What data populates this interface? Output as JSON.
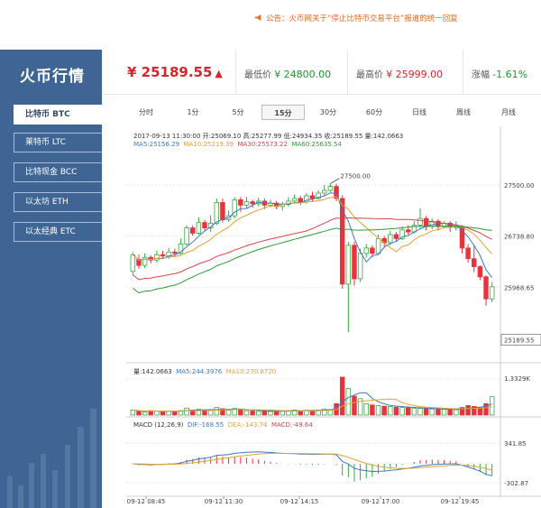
{
  "notice": {
    "text": "公告：火币网关于“停止比特币交易平台”报道的统一回复"
  },
  "sidebar": {
    "title": "火币行情",
    "items": [
      {
        "label": "比特币 BTC",
        "active": true
      },
      {
        "label": "莱特币 LTC",
        "active": false
      },
      {
        "label": "比特现金 BCC",
        "active": false
      },
      {
        "label": "以太坊 ETH",
        "active": false
      },
      {
        "label": "以太经典 ETC",
        "active": false
      }
    ]
  },
  "ticker": {
    "price": "¥ 25189.55",
    "low_label": "最低价",
    "low_value": "¥ 24800.00",
    "high_label": "最高价",
    "high_value": "¥ 25999.00",
    "change_label": "涨幅",
    "change_value": "-1.61%"
  },
  "tabs": [
    "分时",
    "1分",
    "5分",
    "15分",
    "30分",
    "60分",
    "日线",
    "周线",
    "月线"
  ],
  "active_tab": "15分",
  "colors": {
    "up": "#2fae3f",
    "down": "#e8323c",
    "ma5": "#3b78c4",
    "ma10": "#e6a230",
    "ma30": "#d9464a",
    "ma60": "#2f9a34",
    "sidebar": "#3e6593"
  },
  "legend": {
    "info": "2017-09-13 11:30:00  开:25069.10  高:25277.99  低:24934.35  收:25189.55  量:142.0663",
    "ma5": "MA5:25156.29",
    "ma10": "MA10:25219.39",
    "ma30": "MA30:25573.22",
    "ma60": "MA60:25635.54",
    "vol": "量:142.0663",
    "vol_ma5": "MA5:244.3976",
    "vol_ma10": "MA10:270.8720",
    "macd": "MACD  (12,26,9)",
    "dif": "DIF:-168.55",
    "dea": "DEA:-143.74",
    "macd_val": "MACD:-49.64"
  },
  "chart_data": {
    "type": "candlestick",
    "price_axis": {
      "ticks": [
        27500.0,
        26738.8,
        25968.65
      ],
      "last": 25189.55,
      "ymin": 24900,
      "ymax": 28000,
      "max_marker": 27500.0
    },
    "volume_axis": {
      "ticks": [
        "1.3329K"
      ]
    },
    "macd_axis": {
      "ticks": [
        341.85,
        -302.87
      ]
    },
    "x_ticks": [
      "09-12 08:45",
      "09-12 11:30",
      "09-12 14:15",
      "09-12 17:00",
      "09-12 19:45"
    ],
    "candles": [
      [
        26210,
        26460,
        26150,
        26500
      ],
      [
        26390,
        26300,
        26250,
        26460
      ],
      [
        26300,
        26420,
        26260,
        26480
      ],
      [
        26420,
        26380,
        26330,
        26450
      ],
      [
        26380,
        26460,
        26340,
        26520
      ],
      [
        26460,
        26440,
        26400,
        26520
      ],
      [
        26440,
        26500,
        26400,
        26560
      ],
      [
        26500,
        26480,
        26440,
        26550
      ],
      [
        26480,
        26620,
        26460,
        26700
      ],
      [
        26620,
        26860,
        26600,
        26900
      ],
      [
        26860,
        26780,
        26740,
        26900
      ],
      [
        26780,
        26940,
        26760,
        27020
      ],
      [
        26940,
        26860,
        26820,
        26980
      ],
      [
        26860,
        26930,
        26800,
        27050
      ],
      [
        26930,
        27240,
        26900,
        27300
      ],
      [
        27240,
        26980,
        26940,
        27300
      ],
      [
        26980,
        27040,
        26950,
        27120
      ],
      [
        27040,
        27280,
        27000,
        27320
      ],
      [
        27280,
        27200,
        27100,
        27320
      ],
      [
        27200,
        27250,
        27150,
        27320
      ],
      [
        27250,
        27220,
        27160,
        27280
      ],
      [
        27220,
        27260,
        27180,
        27310
      ],
      [
        27260,
        27200,
        27140,
        27300
      ],
      [
        27200,
        27230,
        27170,
        27280
      ],
      [
        27230,
        27180,
        27140,
        27260
      ],
      [
        27180,
        27210,
        27120,
        27250
      ],
      [
        27210,
        27260,
        27180,
        27320
      ],
      [
        27260,
        27300,
        27220,
        27360
      ],
      [
        27300,
        27250,
        27200,
        27340
      ],
      [
        27250,
        27340,
        27220,
        27380
      ],
      [
        27340,
        27300,
        27260,
        27400
      ],
      [
        27300,
        27380,
        27280,
        27420
      ],
      [
        27380,
        27420,
        27340,
        27500
      ],
      [
        27420,
        27480,
        27400,
        27520
      ],
      [
        27480,
        27300,
        27260,
        27520
      ],
      [
        27300,
        26020,
        25950,
        27350
      ],
      [
        26020,
        26600,
        25300,
        26650
      ],
      [
        26600,
        26100,
        26000,
        26650
      ],
      [
        26100,
        26480,
        26050,
        26550
      ],
      [
        26480,
        26560,
        26420,
        26620
      ],
      [
        26560,
        26480,
        26420,
        26600
      ],
      [
        26480,
        26700,
        26460,
        26760
      ],
      [
        26700,
        26640,
        26580,
        26740
      ],
      [
        26640,
        26760,
        26600,
        26820
      ],
      [
        26760,
        26700,
        26660,
        26800
      ],
      [
        26700,
        26830,
        26680,
        26880
      ],
      [
        26830,
        26800,
        26760,
        26900
      ],
      [
        26800,
        26900,
        26780,
        26960
      ],
      [
        26900,
        27000,
        26860,
        27150
      ],
      [
        27000,
        26880,
        26820,
        27040
      ],
      [
        26880,
        26960,
        26840,
        27000
      ],
      [
        26960,
        26880,
        26820,
        26990
      ],
      [
        26880,
        26930,
        26860,
        26960
      ],
      [
        26930,
        26870,
        26800,
        26960
      ],
      [
        26870,
        26880,
        26820,
        26960
      ],
      [
        26880,
        26560,
        26480,
        26900
      ],
      [
        26560,
        26400,
        26340,
        26620
      ],
      [
        26400,
        26280,
        26200,
        26600
      ],
      [
        26280,
        26130,
        26080,
        26300
      ],
      [
        26130,
        25800,
        25700,
        26150
      ],
      [
        25800,
        25980,
        25750,
        26050
      ]
    ],
    "volumes": [
      40,
      30,
      25,
      35,
      30,
      28,
      32,
      26,
      35,
      55,
      40,
      45,
      35,
      38,
      60,
      50,
      38,
      52,
      40,
      35,
      32,
      30,
      34,
      28,
      30,
      32,
      36,
      40,
      34,
      38,
      36,
      40,
      48,
      44,
      90,
      300,
      210,
      150,
      130,
      90,
      80,
      75,
      70,
      68,
      62,
      60,
      58,
      55,
      52,
      50,
      48,
      46,
      45,
      44,
      42,
      60,
      75,
      68,
      62,
      90,
      145
    ]
  }
}
